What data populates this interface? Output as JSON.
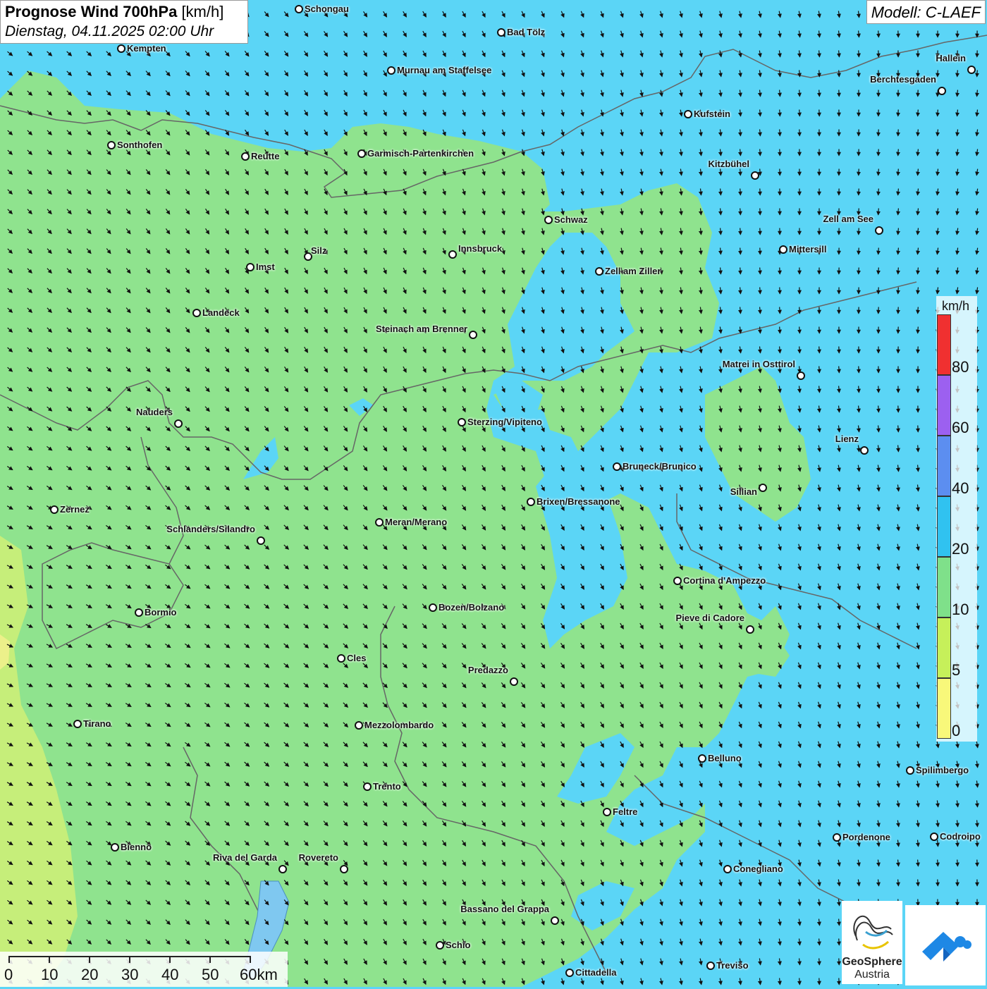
{
  "title": {
    "name": "Prognose Wind 700hPa",
    "unit": "[km/h]",
    "datetime": "Dienstag, 04.11.2025 02:00 Uhr"
  },
  "model": "Modell: C-LAEF",
  "legend": {
    "unit": "km/h",
    "ticks": [
      "80",
      "60",
      "40",
      "20",
      "10",
      "5",
      "0"
    ],
    "colors": {
      "80plus": "#f03030",
      "60_80": "#9c60f0",
      "40_60": "#5c8ef0",
      "20_40": "#30c2f0",
      "10_20": "#7fe08a",
      "5_10": "#c6f05a",
      "0_5": "#f8f87a"
    }
  },
  "scale": {
    "labels": [
      "0",
      "10",
      "20",
      "30",
      "40",
      "50",
      "60km"
    ]
  },
  "cities": [
    {
      "name": "Schongau"
    },
    {
      "name": "Bad Tölz"
    },
    {
      "name": "Kempten"
    },
    {
      "name": "Murnau am Staffelsee"
    },
    {
      "name": "Hallein"
    },
    {
      "name": "Berchtesgaden"
    },
    {
      "name": "Kufstein"
    },
    {
      "name": "Sonthofen"
    },
    {
      "name": "Reutte"
    },
    {
      "name": "Garmisch-Partenkirchen"
    },
    {
      "name": "Kitzbühel"
    },
    {
      "name": "Schwaz"
    },
    {
      "name": "Zell am See"
    },
    {
      "name": "Mittersill"
    },
    {
      "name": "Innsbruck"
    },
    {
      "name": "Silz"
    },
    {
      "name": "Imst"
    },
    {
      "name": "Zell am Ziller"
    },
    {
      "name": "Landeck"
    },
    {
      "name": "Steinach am Brenner"
    },
    {
      "name": "Matrei in Osttirol"
    },
    {
      "name": "Nauders"
    },
    {
      "name": "Sterzing/Vipiteno"
    },
    {
      "name": "Lienz"
    },
    {
      "name": "Bruneck/Brunico"
    },
    {
      "name": "Sillian"
    },
    {
      "name": "Brixen/Bressanone"
    },
    {
      "name": "Zernez"
    },
    {
      "name": "Meran/Merano"
    },
    {
      "name": "Schlanders/Silandro"
    },
    {
      "name": "Cortina d'Ampezzo"
    },
    {
      "name": "Bormio"
    },
    {
      "name": "Bozen/Bolzano"
    },
    {
      "name": "Pieve di Cadore"
    },
    {
      "name": "Cles"
    },
    {
      "name": "Predazzo"
    },
    {
      "name": "Tirano"
    },
    {
      "name": "Mezzolombardo"
    },
    {
      "name": "Belluno"
    },
    {
      "name": "Spilimbergo"
    },
    {
      "name": "Trento"
    },
    {
      "name": "Feltre"
    },
    {
      "name": "Pordenone"
    },
    {
      "name": "Codroipo"
    },
    {
      "name": "Bienno"
    },
    {
      "name": "Riva del Garda"
    },
    {
      "name": "Rovereto"
    },
    {
      "name": "Conegliano"
    },
    {
      "name": "Bassano del Grappa"
    },
    {
      "name": "Schio"
    },
    {
      "name": "Treviso"
    },
    {
      "name": "Cittadella"
    }
  ],
  "logos": {
    "geosphere_line1": "GeoSphere",
    "geosphere_line2": "Austria"
  }
}
